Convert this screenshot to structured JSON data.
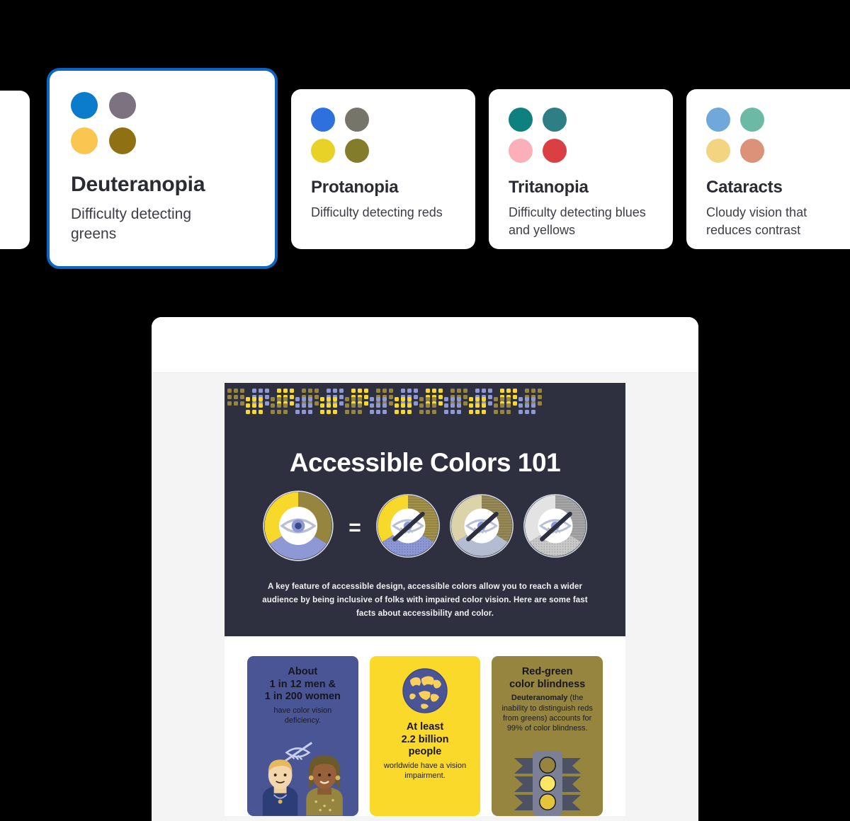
{
  "vision_cards": [
    {
      "name": "",
      "description": "",
      "selected": false,
      "partial": true,
      "swatches": []
    },
    {
      "name": "Deuteranopia",
      "description": "Difficulty detecting greens",
      "selected": true,
      "partial": false,
      "swatches": [
        "#0B7CCB",
        "#7D7380",
        "#FBC552",
        "#8F7012"
      ]
    },
    {
      "name": "Protanopia",
      "description": "Difficulty detecting reds",
      "selected": false,
      "partial": false,
      "swatches": [
        "#2E71DE",
        "#75756A",
        "#E8D227",
        "#837C2A"
      ]
    },
    {
      "name": "Tritanopia",
      "description": "Difficulty detecting blues and yellows",
      "selected": false,
      "partial": false,
      "swatches": [
        "#0E8080",
        "#2E7E86",
        "#FBAFB8",
        "#DA3F43"
      ]
    },
    {
      "name": "Cataracts",
      "description": "Cloudy vision that reduces contrast",
      "selected": false,
      "partial": false,
      "swatches": [
        "#70A8DC",
        "#6CB9A6",
        "#F3D581",
        "#DB9279"
      ]
    }
  ],
  "selection_accent": "#0B66C3",
  "browser": {
    "chrome_empty": true
  },
  "infographic": {
    "title": "Accessible Colors 101",
    "lede": "A key feature of accessible design, accessible colors allow you to reach a wider audience by being inclusive of folks with impaired color vision. Here are some fast facts about accessibility and color.",
    "hero_bg": "#2e3040",
    "equals_sign": "=",
    "pattern_colors": [
      "#96853f",
      "#8e98d4",
      "#f7d82b"
    ],
    "eye_wheels": [
      {
        "name": "full-color-vision-wheel",
        "eye": "open",
        "segments": [
          "#f7d82b",
          "#96853f",
          "#8e98d4"
        ]
      },
      {
        "name": "deuteranopia-wheel",
        "eye": "crossed",
        "segments": [
          "#f7d82b",
          "#96853f",
          "#8e98d4"
        ]
      },
      {
        "name": "protanopia-wheel",
        "eye": "crossed",
        "segments": [
          "#ddd3ab",
          "#8c7f4d",
          "#b4bcd2"
        ]
      },
      {
        "name": "achromatopsia-wheel",
        "eye": "crossed",
        "segments": [
          "#e3e3e3",
          "#9b9b9b",
          "#c9c9c9"
        ]
      }
    ],
    "facts": [
      {
        "id": "fact-statistics",
        "bg": "#4a5596",
        "headline": "About\n1 in 12 men &\n1 in 200 women",
        "headline_lines": [
          "About",
          "1 in 12 men &",
          "1 in 200 women"
        ],
        "subtext": "have color vision deficiency.",
        "art": "two-people-illustration",
        "art_icon": "crossed-eye-icon"
      },
      {
        "id": "fact-worldwide",
        "bg": "#fbd92a",
        "headline_lines": [
          "At least",
          "2.2 billion",
          "people"
        ],
        "subtext": "worldwide have a vision impairment.",
        "art": "globe-illustration"
      },
      {
        "id": "fact-red-green",
        "bg": "#96853f",
        "headline_lines": [
          "Red-green",
          "color blindness"
        ],
        "subtext_bold": "Deuteranomaly",
        "subtext": " (the inability to distinguish reds from greens) accounts for 99% of color blindness.",
        "art": "traffic-light-illustration"
      }
    ]
  }
}
